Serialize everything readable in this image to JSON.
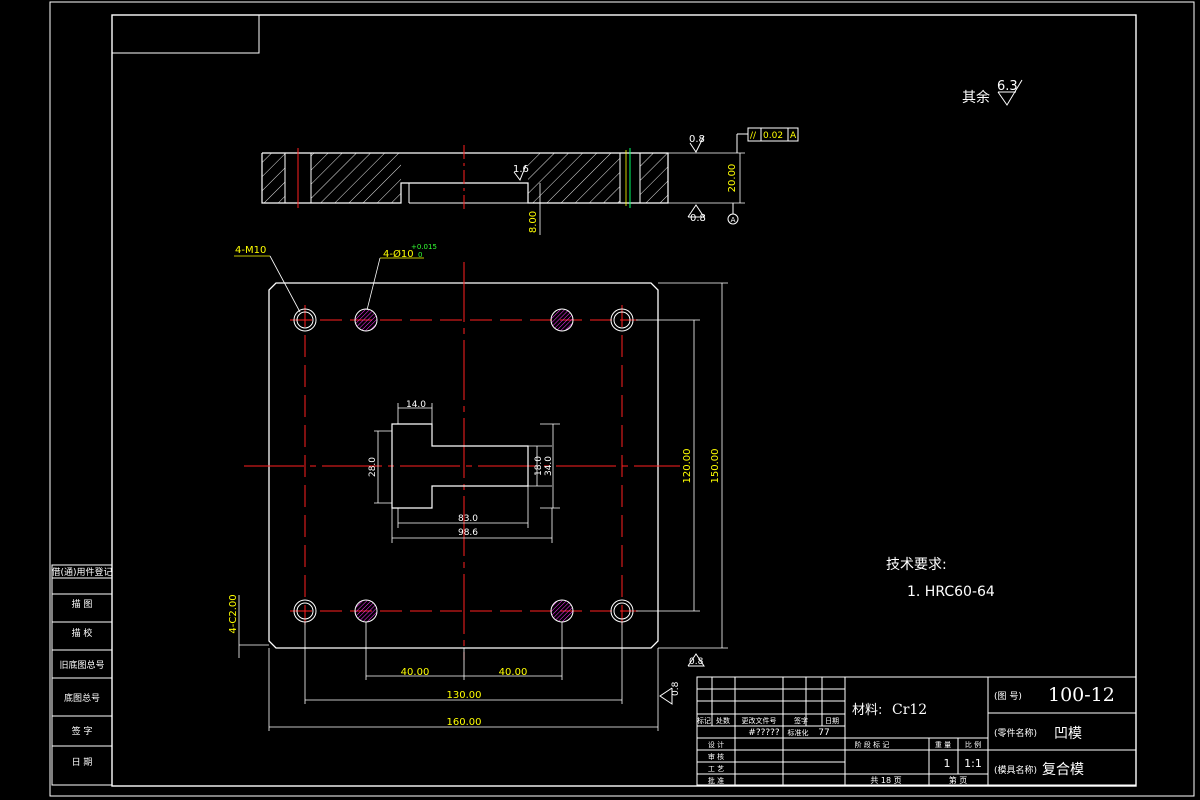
{
  "roughness": {
    "label": "其余",
    "value": "6.3"
  },
  "side_view": {
    "roughness_top": "0.8",
    "roughness_bottom": "0.8",
    "roughness_step": "1.6",
    "parallelism": {
      "symbol": "//",
      "tolerance": "0.02",
      "datum": "A"
    },
    "datum_label": "A",
    "dim_thickness": "20.00",
    "dim_step": "8.00"
  },
  "plan_view": {
    "callout_threads": "4-M10",
    "callout_pins": "4-Ø10",
    "callout_pins_tolerance": "+0.015",
    "callout_pins_tolerance_low": "0",
    "callout_chamfer": "4-C2.00",
    "dim_slot_neck": "14.0",
    "dim_slot_height": "28.0",
    "dim_slot_inner_h": "18.0",
    "dim_slot_outer_h": "34.0",
    "dim_slot_inner_w": "83.0",
    "dim_slot_outer_w": "98.6",
    "dim_hole_pitch_y": "120.00",
    "dim_height": "150.00",
    "dim_half_left": "40.00",
    "dim_half_right": "40.00",
    "dim_hole_pitch_x": "130.00",
    "dim_width": "160.00",
    "roughness_bottom": "0.8",
    "roughness_right": "0.8"
  },
  "tech_requirements": {
    "title": "技术要求:",
    "items": [
      "1. HRC60-64"
    ]
  },
  "side_panel": {
    "labels": [
      "借(通)用件登记",
      "描 图",
      "描 校",
      "旧底图总号",
      "底图总号",
      "签 字",
      "日 期"
    ]
  },
  "title_block": {
    "material_label": "材料:",
    "material": "Cr12",
    "drawing_no_label": "(图 号)",
    "drawing_no": "100-12",
    "part_name_label": "(零件名称)",
    "part_name": "凹模",
    "die_name_label": "(模具名称)",
    "die_name": "复合模",
    "row_labels": [
      "标记",
      "处数",
      "更改文件号",
      "签字",
      "日期"
    ],
    "design_label": "设 计",
    "design_value": "#?????",
    "std_label": "标准化",
    "std_value": "77",
    "check_label": "审 核",
    "process_label": "工 艺",
    "approve_label": "批 准",
    "stage_labels": [
      "阶 段 标 记",
      "重 量",
      "比 例"
    ],
    "quantity": "1",
    "scale": "1:1",
    "sheets_total": "共 18 页",
    "sheet_no": "第 页"
  }
}
